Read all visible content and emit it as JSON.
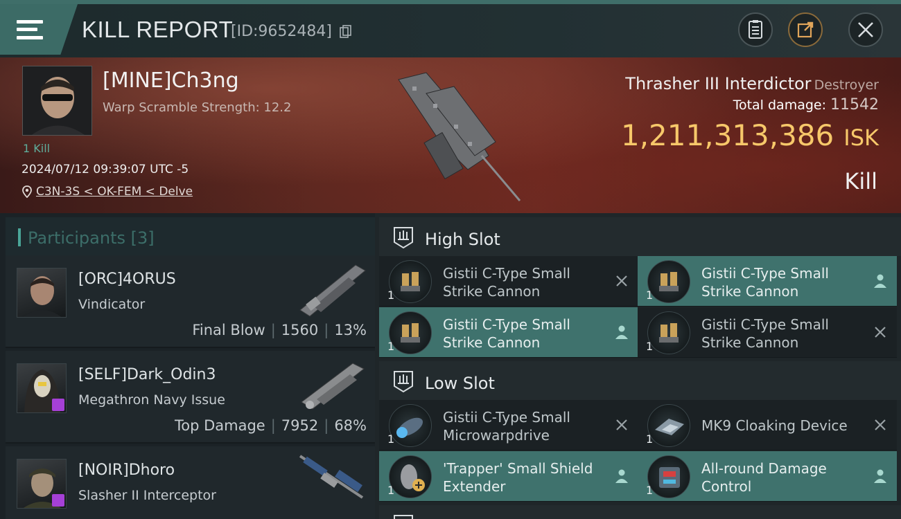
{
  "header": {
    "title": "KILL REPORT",
    "report_id": "[ID:9652484]",
    "icons": [
      "menu-icon",
      "copy-icon",
      "document-icon",
      "share-icon",
      "close-icon"
    ]
  },
  "victim": {
    "name": "[MINE]Ch3ng",
    "subtitle": "Warp Scramble Strength: 12.2",
    "kills": "1 Kill",
    "datetime": "2024/07/12 09:39:07 UTC -5",
    "location": "C3N-3S < OK-FEM < Delve",
    "ship_name": "Thrasher III Interdictor",
    "ship_class": "Destroyer",
    "damage_label": "Total damage:",
    "damage_value": "11542",
    "isk_value": "1,211,313,386",
    "isk_unit": "ISK",
    "report_type": "Kill"
  },
  "participants": {
    "label": "Participants",
    "count": "[3]",
    "rows": [
      {
        "name": "[ORC]4ORUS",
        "ship": "Vindicator",
        "stat_label": "Final Blow",
        "damage": "1560",
        "percent": "13%"
      },
      {
        "name": "[SELF]Dark_Odin3",
        "ship": "Megathron Navy Issue",
        "stat_label": "Top Damage",
        "damage": "7952",
        "percent": "68%"
      },
      {
        "name": "[NOIR]Dhoro",
        "ship": "Slasher II Interceptor"
      }
    ]
  },
  "fitting": {
    "high_slot_label": "High Slot",
    "low_slot_label": "Low Slot",
    "high": [
      {
        "name": "Gistii C-Type Small Strike Cannon",
        "qty": "1",
        "status": "destroyed"
      },
      {
        "name": "Gistii C-Type Small Strike Cannon",
        "qty": "1",
        "status": "dropped"
      },
      {
        "name": "Gistii C-Type Small Strike Cannon",
        "qty": "1",
        "status": "dropped"
      },
      {
        "name": "Gistii C-Type Small Strike Cannon",
        "qty": "1",
        "status": "destroyed"
      }
    ],
    "low": [
      {
        "name": "Gistii C-Type Small Microwarpdrive",
        "qty": "1",
        "status": "destroyed"
      },
      {
        "name": "MK9 Cloaking Device",
        "qty": "1",
        "status": "destroyed"
      },
      {
        "name": "'Trapper' Small Shield Extender",
        "qty": "1",
        "status": "dropped"
      },
      {
        "name": "All-round Damage Control",
        "qty": "1",
        "status": "dropped"
      }
    ]
  },
  "colors": {
    "accent_teal": "#3f726d",
    "isk_gold": "#f7c86a",
    "kill_green": "#5fae9c"
  }
}
